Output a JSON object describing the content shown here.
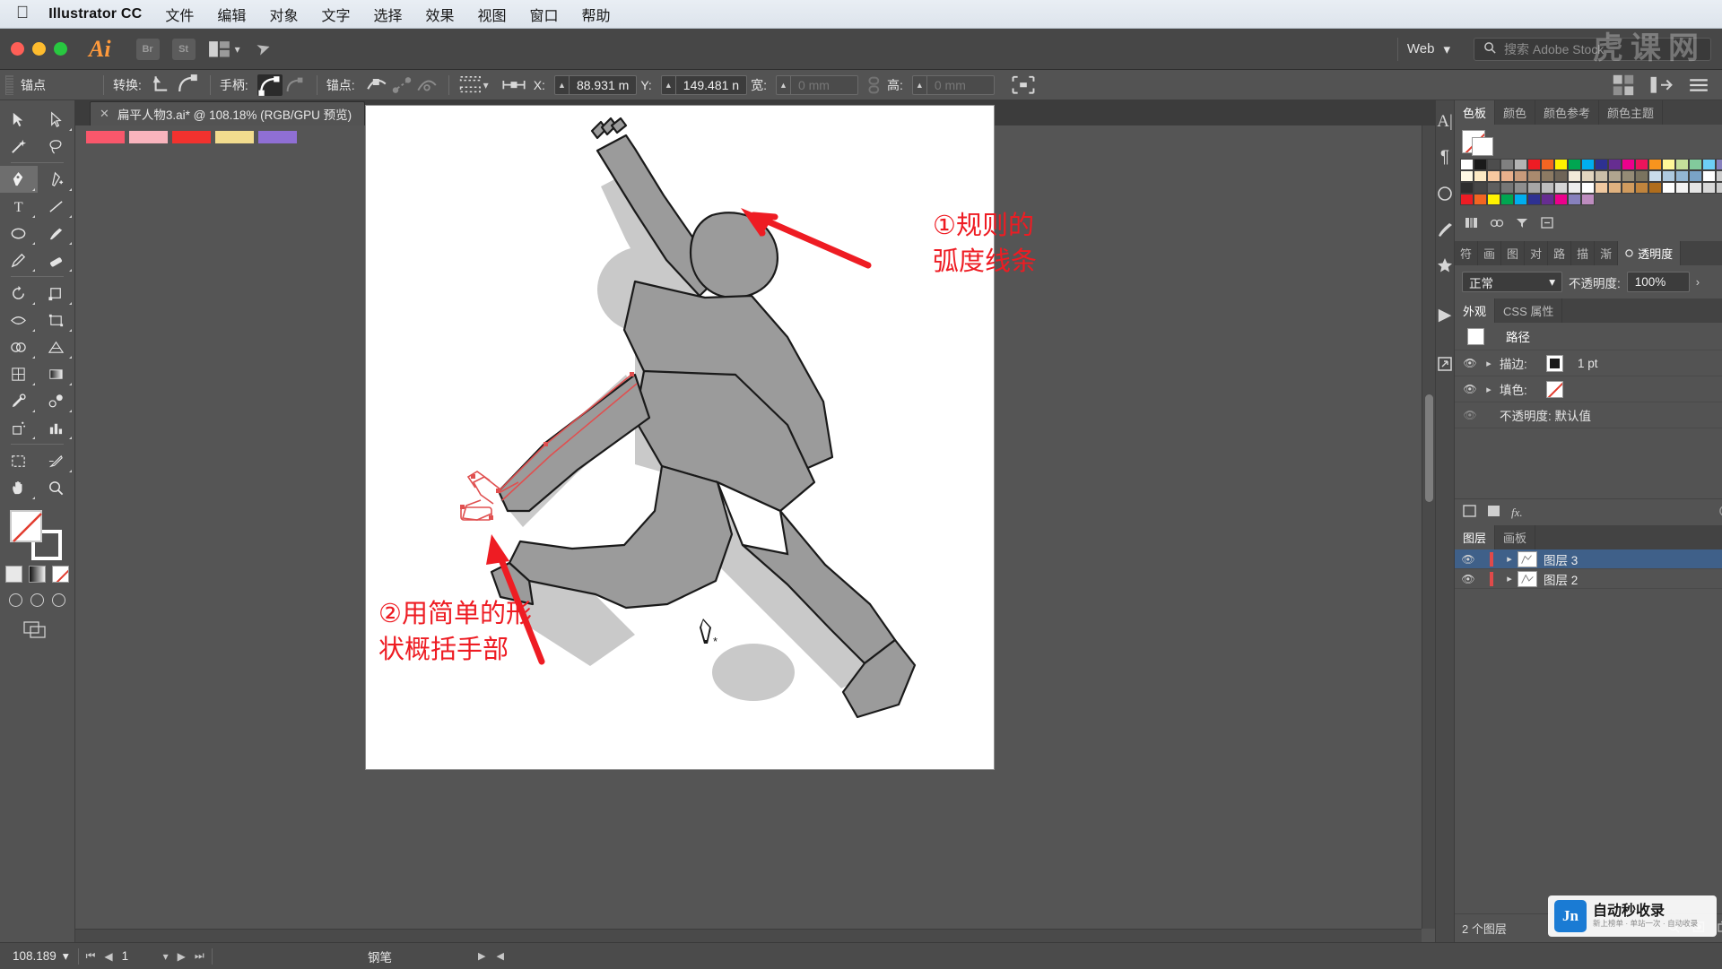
{
  "macbar": {
    "apple_icon": "apple-icon",
    "app_name": "Illustrator CC",
    "menus": [
      "文件",
      "编辑",
      "对象",
      "文字",
      "选择",
      "效果",
      "视图",
      "窗口",
      "帮助"
    ]
  },
  "titlebar": {
    "ai_logo": "Ai",
    "bridge_label": "Br",
    "stock_label": "St",
    "arrange_icon": "arrange-documents-icon",
    "chevron_icon": "chevron-down-icon",
    "rocket_icon": "rocket-icon",
    "workspace": "Web",
    "workspace_chevron": "chevron-down-icon",
    "search_icon": "search-icon",
    "search_placeholder": "搜索 Adobe Stock"
  },
  "controlbar": {
    "title": "锚点",
    "convert_label": "转换:",
    "convert_icons": [
      "convert-to-corner-icon",
      "convert-to-smooth-icon"
    ],
    "handles_label": "手柄:",
    "handle_icons": [
      "show-handles-icon",
      "hide-handles-icon"
    ],
    "anchors_label": "锚点:",
    "anchor_icons": [
      "remove-anchor-icon",
      "connect-anchor-icon",
      "cut-path-icon"
    ],
    "align_icon": "align-objects-icon",
    "transform_icon": "transform-reference-icon",
    "x_label": "X:",
    "x_value": "88.931 m",
    "y_label": "Y:",
    "y_value": "149.481 n",
    "w_label": "宽:",
    "w_value": "0 mm",
    "h_label": "高:",
    "h_value": "0 mm",
    "constrain_icon": "link-proportions-icon",
    "isolate_icon": "isolate-selected-icon",
    "right_icons": [
      "document-setup-icon",
      "arrange-icon",
      "panel-menu-icon"
    ]
  },
  "tab": {
    "close_icon": "close-icon",
    "title": "扁平人物3.ai* @ 108.18% (RGB/GPU 预览)"
  },
  "toolbar": {
    "tools": [
      {
        "name": "selection-tool",
        "active": false
      },
      {
        "name": "direct-selection-tool",
        "active": false
      },
      {
        "name": "magic-wand-tool",
        "active": false
      },
      {
        "name": "lasso-tool",
        "active": false
      },
      {
        "name": "pen-tool",
        "active": true
      },
      {
        "name": "add-anchor-point-tool",
        "active": false
      },
      {
        "name": "type-tool",
        "active": false
      },
      {
        "name": "line-segment-tool",
        "active": false
      },
      {
        "name": "ellipse-tool",
        "active": false
      },
      {
        "name": "paintbrush-tool",
        "active": false
      },
      {
        "name": "pencil-tool",
        "active": false
      },
      {
        "name": "eraser-tool",
        "active": false
      },
      {
        "name": "rotate-tool",
        "active": false
      },
      {
        "name": "scale-tool",
        "active": false
      },
      {
        "name": "width-tool",
        "active": false
      },
      {
        "name": "free-transform-tool",
        "active": false
      },
      {
        "name": "shape-builder-tool",
        "active": false
      },
      {
        "name": "perspective-grid-tool",
        "active": false
      },
      {
        "name": "mesh-tool",
        "active": false
      },
      {
        "name": "gradient-tool",
        "active": false
      },
      {
        "name": "eyedropper-tool",
        "active": false
      },
      {
        "name": "blend-tool",
        "active": false
      },
      {
        "name": "symbol-sprayer-tool",
        "active": false
      },
      {
        "name": "column-graph-tool",
        "active": false
      },
      {
        "name": "artboard-tool",
        "active": false
      },
      {
        "name": "slice-tool",
        "active": false
      },
      {
        "name": "hand-tool",
        "active": false
      },
      {
        "name": "zoom-tool",
        "active": false
      }
    ],
    "fill_swatch": "fill-none-swatch",
    "stroke_swatch": "stroke-white-swatch",
    "mini_swatches": [
      "color-swatch",
      "gradient-swatch",
      "none-swatch"
    ],
    "screen_modes": [
      "normal-screen-mode",
      "full-screen-menu-mode",
      "full-screen-mode"
    ],
    "final_icon": "change-screen-mode-icon"
  },
  "canvas": {
    "swatch_strip": [
      "#F9576B",
      "#F9B4BD",
      "#F2322E",
      "#F2DC8E",
      "#8F6FD4"
    ],
    "scrollbar_icon": "vertical-scrollbar",
    "cursor_icon": "pen-tool-cursor",
    "annotations": [
      {
        "name": "annotation-1",
        "text": "①规则的\n弧度线条",
        "color": "#EE1C23"
      },
      {
        "name": "annotation-2",
        "text": "②用简单的形\n状概括手部",
        "color": "#EE1C23"
      }
    ],
    "arrows": [
      "arrow-to-head",
      "arrow-to-hand"
    ],
    "figure_fill": "#9B9B9B",
    "figure_shadow": "#C9C9C9",
    "path_highlight": "#E05050"
  },
  "right_rail": {
    "icons": [
      "character-panel-icon",
      "paragraph-panel-icon",
      "graphic-styles-icon",
      "brushes-panel-icon",
      "symbols-panel-icon",
      "actions-panel-icon",
      "links-panel-icon"
    ]
  },
  "swatches_panel": {
    "tabs": [
      {
        "label": "色板",
        "active": true
      },
      {
        "label": "颜色",
        "active": false
      },
      {
        "label": "颜色参考",
        "active": false
      },
      {
        "label": "颜色主题",
        "active": false
      }
    ],
    "menu_icon": "panel-menu-icon",
    "none_swatch": "none-swatch",
    "view_icons": [
      "list-view-icon",
      "grid-view-icon"
    ],
    "rows": [
      [
        "#FFFFFF",
        "#1A1A1A",
        "#4D4D4D",
        "#808080",
        "#B3B3B3",
        "#ED1C24",
        "#F26522",
        "#FFF200",
        "#00A651",
        "#00AEEF",
        "#2E3192",
        "#662D91",
        "#EC008C",
        "#ED145B",
        "#F7941E",
        "#FFF799",
        "#C4DF9B",
        "#82CA9C",
        "#6DCFF6",
        "#8781BD",
        "#BD8CBF",
        "#F49AC2",
        "#F9AD81",
        "#FCD9A3"
      ],
      [
        "#FFF9E5",
        "#FCE9C4",
        "#F7C9A0",
        "#E8B08C",
        "#C89B7B",
        "#A98A6E",
        "#8C7A63",
        "#6E6457",
        "#F2E9D8",
        "#E2D6C0",
        "#CBBFA8",
        "#B0A58F",
        "#948B76",
        "#7A735F",
        "#C9DCEB",
        "#AEC9DF",
        "#93B6D3",
        "#7AA3C7",
        "#ffffff",
        "#cccccc",
        "#999999",
        "#666666",
        "#333333",
        "#000000"
      ],
      [
        "#2E2E2E",
        "#464646",
        "#5E5E5E",
        "#767676",
        "#8E8E8E",
        "#A6A6A6",
        "#BEBEBE",
        "#D6D6D6",
        "#EDEDED",
        "#FFFFFF",
        "#F0C9A0",
        "#E0B27F",
        "#D09B5E",
        "#C0843D",
        "#B06D1C",
        "#FFFFFF",
        "#F2F2F2",
        "#E5E5E5",
        "#D8D8D8",
        "#CBCBCB",
        "#1A1A1A",
        "#4D4D4D",
        "#80C342",
        "#2BB673"
      ],
      [
        "#ED1C24",
        "#F26522",
        "#FFF200",
        "#00A651",
        "#00AEEF",
        "#2E3192",
        "#662D91",
        "#EC008C",
        "#8781BD",
        "#BD8CBF"
      ]
    ],
    "tool_icons": [
      "swatch-libraries-icon",
      "color-group-icon",
      "show-swatch-kinds-icon",
      "swatch-options-icon",
      "new-color-group-icon",
      "new-swatch-icon",
      "delete-swatch-icon"
    ]
  },
  "transparency_panel": {
    "tabs": [
      {
        "label": "符",
        "active": false
      },
      {
        "label": "画",
        "active": false
      },
      {
        "label": "图",
        "active": false
      },
      {
        "label": "对",
        "active": false
      },
      {
        "label": "路",
        "active": false
      },
      {
        "label": "描",
        "active": false
      },
      {
        "label": "渐",
        "active": false
      },
      {
        "label": "透明度",
        "active": true
      }
    ],
    "menu_icon": "panel-menu-icon",
    "blend_mode": "正常",
    "blend_chevron": "chevron-down-icon",
    "opacity_label": "不透明度:",
    "opacity_value": "100%",
    "expand_icon": "chevron-right-icon"
  },
  "appearance_panel": {
    "tabs": [
      {
        "label": "外观",
        "active": true
      },
      {
        "label": "CSS 属性",
        "active": false
      }
    ],
    "menu_icon": "panel-menu-icon",
    "target_label": "路径",
    "rows": [
      {
        "name": "stroke-row",
        "label": "描边:",
        "value": "1 pt",
        "eye": "eye-icon",
        "twist": "chevron-right-icon",
        "chip": "stroke-black-chip"
      },
      {
        "name": "fill-row",
        "label": "填色:",
        "value": "",
        "eye": "eye-icon",
        "twist": "chevron-right-icon",
        "chip": "fill-none-chip"
      },
      {
        "name": "opacity-row",
        "label": "不透明度: 默认值",
        "value": "",
        "eye": "eye-icon-dim",
        "twist": "",
        "chip": ""
      }
    ],
    "footer_icons": [
      "add-new-stroke-icon",
      "add-new-fill-icon",
      "add-effect-icon",
      "clear-appearance-icon",
      "duplicate-item-icon",
      "delete-item-icon"
    ]
  },
  "layers_panel": {
    "tabs": [
      {
        "label": "图层",
        "active": true
      },
      {
        "label": "画板",
        "active": false
      }
    ],
    "menu_icon": "panel-menu-icon",
    "layers": [
      {
        "name": "图层 3",
        "selected": true,
        "eye": "eye-icon",
        "lock": "lock-column",
        "twist": "chevron-right-icon",
        "target": "target-circle-icon",
        "indicator": "red-selection-square"
      },
      {
        "name": "图层 2",
        "selected": false,
        "eye": "eye-icon",
        "lock": "lock-column",
        "twist": "chevron-right-icon",
        "target": "target-circle-icon",
        "indicator": ""
      }
    ],
    "footer_text": "2 个图层",
    "footer_icons": [
      "locate-object-icon",
      "make-clipping-mask-icon",
      "create-new-sublayer-icon",
      "create-new-layer-icon",
      "delete-selection-icon"
    ]
  },
  "statusbar": {
    "zoom_value": "108.189",
    "zoom_chevron": "chevron-down-icon",
    "nav_first_icon": "first-artboard-icon",
    "nav_prev_icon": "previous-artboard-icon",
    "page_value": "1",
    "page_chevron": "chevron-down-icon",
    "nav_next_icon": "next-artboard-icon",
    "nav_last_icon": "last-artboard-icon",
    "current_tool": "钢笔",
    "play_icon": "play-icon",
    "collapse_icon": "chevron-left-icon"
  },
  "watermark": {
    "logo": "Jn",
    "title": "自动秒收录",
    "subtitle": "新上榜单 · 单站一次 · 自动收录"
  }
}
